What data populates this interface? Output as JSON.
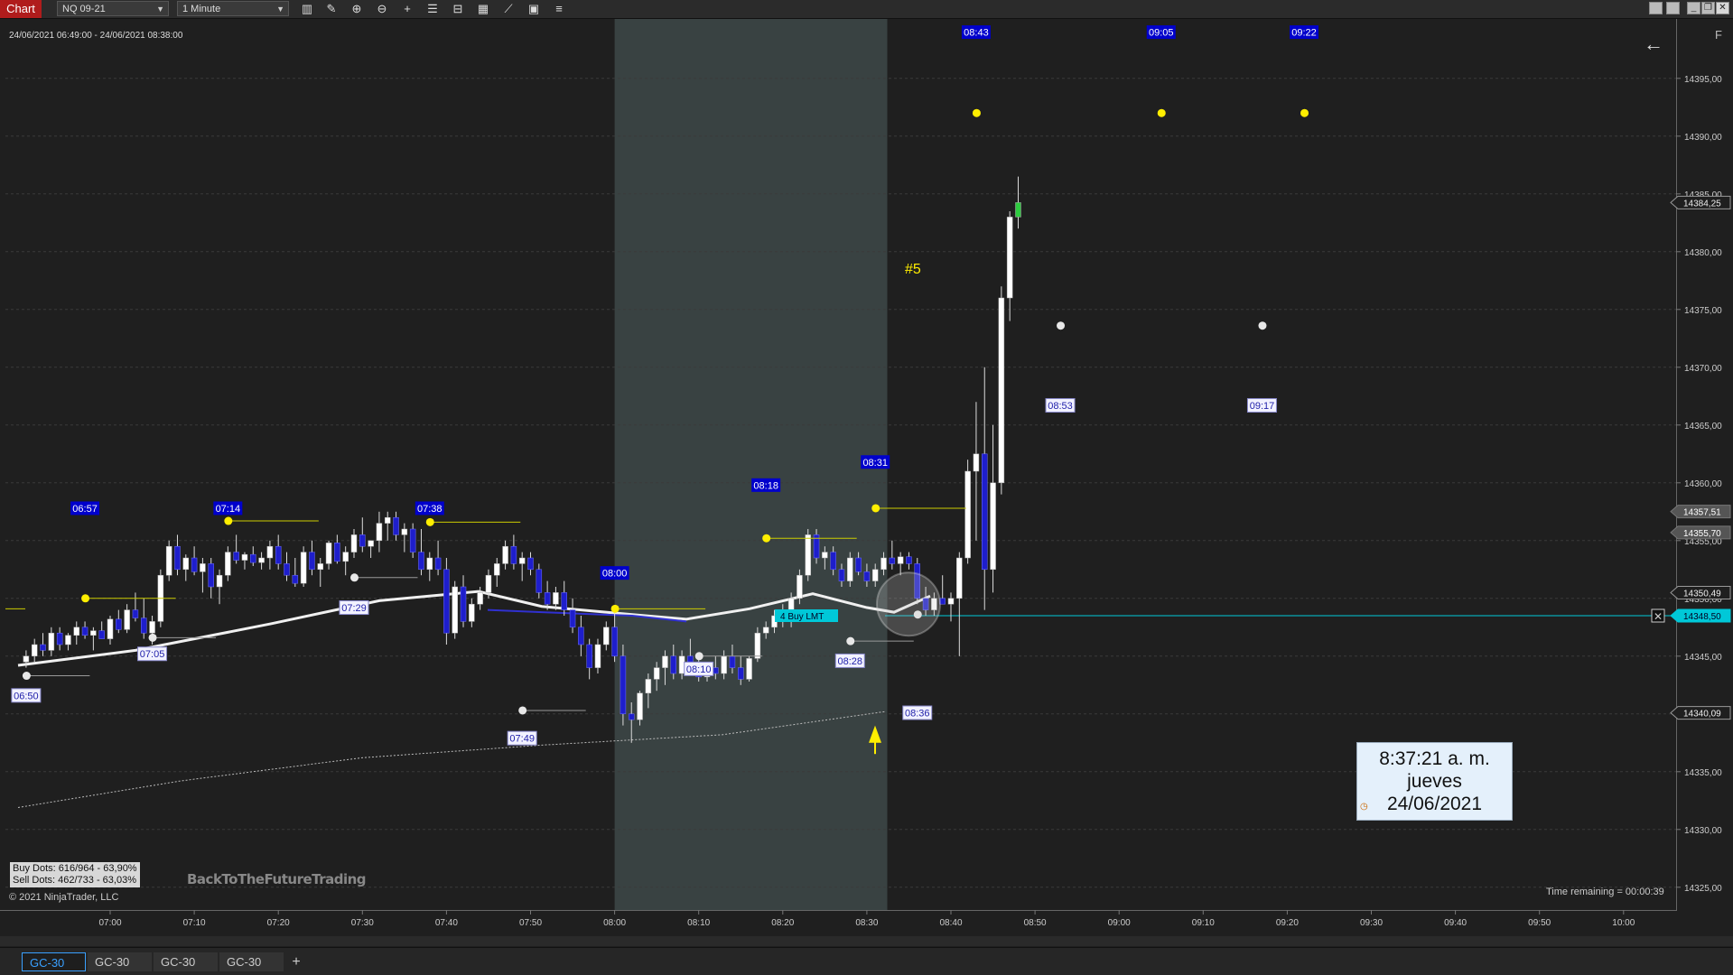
{
  "toolbar": {
    "chart_tab": "Chart",
    "instrument": "NQ 09-21",
    "interval": "1 Minute",
    "icons": [
      "bars-icon",
      "draw-icon",
      "zoom-in-icon",
      "zoom-out-icon",
      "crosshair-icon",
      "properties-icon",
      "templates-icon",
      "indicators-icon",
      "strategies-icon",
      "data-box-icon",
      "list-icon"
    ],
    "window_buttons": [
      "",
      "",
      "",
      "✕"
    ]
  },
  "chart": {
    "range_label": "24/06/2021 06:49:00 - 24/06/2021 08:38:00",
    "back_arrow": "←",
    "f_label": "F",
    "signal_label": "#5",
    "dots_box": [
      "Buy Dots: 616/964 - 63,90%",
      "Sell Dots: 462/733 - 63,03%"
    ],
    "watermark": "BackToTheFutureTrading",
    "copyright": "© 2021 NinjaTrader, LLC",
    "time_remaining": "Time remaining = 00:00:39",
    "order_label": "4  Buy LMT",
    "info_box": [
      "8:37:21 a. m.",
      "jueves",
      "24/06/2021"
    ],
    "colors": {
      "background": "#1f1f1f",
      "session_shade": "#394242",
      "up_candle": "#ffffff",
      "down_candle": "#1e1ecc",
      "last_bar": "#2ecc40",
      "order_line": "#00c8d8",
      "dots_yellow": "#ffee00",
      "label_blue": "#0000cc"
    }
  },
  "chart_data": {
    "type": "candlestick",
    "instrument": "NQ 09-21",
    "x_tick_labels": [
      "07:00",
      "07:10",
      "07:20",
      "07:30",
      "07:40",
      "07:50",
      "08:00",
      "08:10",
      "08:20",
      "08:30",
      "08:40",
      "08:50",
      "09:00",
      "09:10",
      "09:20",
      "09:30",
      "09:40",
      "09:50",
      "10:00"
    ],
    "y_tick_labels": [
      "14395,00",
      "14390,00",
      "14385,00",
      "14380,00",
      "14375,00",
      "14370,00",
      "14365,00",
      "14360,00",
      "14355,00",
      "14350,00",
      "14345,00",
      "14340,00",
      "14335,00",
      "14330,00",
      "14325,00"
    ],
    "y_range": [
      14324,
      14398
    ],
    "price_markers": [
      {
        "value": "14384,25",
        "style": "dark"
      },
      {
        "value": "14357,51",
        "style": "gray"
      },
      {
        "value": "14355,70",
        "style": "gray"
      },
      {
        "value": "14350,49",
        "style": "dark"
      },
      {
        "value": "14348,50",
        "style": "cyan"
      },
      {
        "value": "14340,09",
        "style": "dark"
      }
    ],
    "time_labels_high": [
      {
        "text": "06:57",
        "price": 14357.8
      },
      {
        "text": "07:14",
        "price": 14357.8
      },
      {
        "text": "07:38",
        "price": 14357.8
      },
      {
        "text": "08:00",
        "price": 14352.2
      },
      {
        "text": "08:18",
        "price": 14359.8
      },
      {
        "text": "08:31",
        "price": 14361.8
      },
      {
        "text": "08:43",
        "price": 14399
      },
      {
        "text": "09:05",
        "price": 14399
      },
      {
        "text": "09:22",
        "price": 14399
      }
    ],
    "time_labels_low": [
      {
        "text": "06:50",
        "price": 14341.6
      },
      {
        "text": "07:05",
        "price": 14345.2
      },
      {
        "text": "07:29",
        "price": 14349.2
      },
      {
        "text": "08:10",
        "price": 14343.9
      },
      {
        "text": "08:28",
        "price": 14344.6
      },
      {
        "text": "07:49",
        "price": 14337.9
      },
      {
        "text": "08:36",
        "price": 14340.1
      },
      {
        "text": "08:53",
        "price": 14366.7
      },
      {
        "text": "09:17",
        "price": 14366.7
      }
    ],
    "yellow_dots": [
      {
        "t": "06:57",
        "price": 14350.0
      },
      {
        "t": "07:14",
        "price": 14356.7
      },
      {
        "t": "07:38",
        "price": 14356.6
      },
      {
        "t": "08:00",
        "price": 14349.1
      },
      {
        "t": "08:18",
        "price": 14355.2
      },
      {
        "t": "08:31",
        "price": 14357.8
      },
      {
        "t": "08:43",
        "price": 14392.0
      },
      {
        "t": "09:05",
        "price": 14392.0
      },
      {
        "t": "09:22",
        "price": 14392.0
      }
    ],
    "white_dots": [
      {
        "t": "06:50",
        "price": 14343.3
      },
      {
        "t": "07:05",
        "price": 14346.6
      },
      {
        "t": "07:29",
        "price": 14351.8
      },
      {
        "t": "07:49",
        "price": 14340.3
      },
      {
        "t": "08:10",
        "price": 14345.0
      },
      {
        "t": "08:28",
        "price": 14346.3
      },
      {
        "t": "08:36",
        "price": 14348.6
      },
      {
        "t": "08:53",
        "price": 14373.6
      },
      {
        "t": "09:17",
        "price": 14373.6
      }
    ],
    "order_price": 14348.5,
    "shaded_session": [
      "08:00",
      "08:32"
    ],
    "candles": [
      [
        14344.5,
        14345.5,
        14344.0,
        14345.0
      ],
      [
        14345.0,
        14346.5,
        14344.5,
        14346.0
      ],
      [
        14346.0,
        14347.0,
        14345.0,
        14345.5
      ],
      [
        14345.5,
        14347.5,
        14345.0,
        14347.0
      ],
      [
        14347.0,
        14347.5,
        14345.5,
        14346.0
      ],
      [
        14346.0,
        14347.0,
        14345.5,
        14346.8
      ],
      [
        14346.8,
        14348.0,
        14346.0,
        14347.5
      ],
      [
        14347.5,
        14348.0,
        14346.5,
        14346.8
      ],
      [
        14346.8,
        14347.5,
        14345.5,
        14347.2
      ],
      [
        14347.2,
        14348.0,
        14346.5,
        14346.5
      ],
      [
        14346.5,
        14348.5,
        14346.0,
        14348.2
      ],
      [
        14348.2,
        14349.0,
        14347.0,
        14347.3
      ],
      [
        14347.3,
        14349.5,
        14347.0,
        14349.0
      ],
      [
        14349.0,
        14350.5,
        14348.0,
        14348.3
      ],
      [
        14348.3,
        14350.0,
        14346.5,
        14347.0
      ],
      [
        14347.0,
        14348.5,
        14346.0,
        14348.0
      ],
      [
        14348.0,
        14352.5,
        14347.5,
        14352.0
      ],
      [
        14352.0,
        14355.0,
        14351.5,
        14354.5
      ],
      [
        14354.5,
        14355.5,
        14352.0,
        14352.5
      ],
      [
        14352.5,
        14353.8,
        14351.5,
        14353.5
      ],
      [
        14353.5,
        14354.5,
        14352.0,
        14352.3
      ],
      [
        14352.3,
        14353.5,
        14350.5,
        14353.0
      ],
      [
        14353.0,
        14353.5,
        14350.0,
        14351.0
      ],
      [
        14351.0,
        14352.5,
        14349.5,
        14352.0
      ],
      [
        14352.0,
        14354.5,
        14351.5,
        14354.0
      ],
      [
        14354.0,
        14355.5,
        14353.0,
        14353.3
      ],
      [
        14353.3,
        14354.0,
        14352.5,
        14353.8
      ],
      [
        14353.8,
        14354.5,
        14352.8,
        14353.1
      ],
      [
        14353.1,
        14354.0,
        14352.5,
        14353.5
      ],
      [
        14353.5,
        14355.0,
        14352.5,
        14354.5
      ],
      [
        14354.5,
        14355.5,
        14352.5,
        14353.0
      ],
      [
        14353.0,
        14354.0,
        14351.5,
        14352.0
      ],
      [
        14352.0,
        14353.5,
        14351.0,
        14351.3
      ],
      [
        14351.3,
        14354.5,
        14351.0,
        14354.0
      ],
      [
        14354.0,
        14355.0,
        14352.0,
        14352.5
      ],
      [
        14352.5,
        14353.5,
        14351.0,
        14353.0
      ],
      [
        14353.0,
        14355.0,
        14352.5,
        14354.8
      ],
      [
        14354.8,
        14355.5,
        14353.0,
        14353.2
      ],
      [
        14353.2,
        14354.5,
        14352.0,
        14354.0
      ],
      [
        14354.0,
        14356.0,
        14353.5,
        14355.5
      ],
      [
        14355.5,
        14357.0,
        14354.0,
        14354.5
      ],
      [
        14354.5,
        14355.0,
        14353.5,
        14355.0
      ],
      [
        14355.0,
        14357.5,
        14354.0,
        14356.5
      ],
      [
        14356.5,
        14357.5,
        14355.0,
        14357.0
      ],
      [
        14357.0,
        14357.5,
        14355.0,
        14355.5
      ],
      [
        14355.5,
        14356.5,
        14354.0,
        14356.0
      ],
      [
        14356.0,
        14356.5,
        14353.5,
        14354.0
      ],
      [
        14354.0,
        14356.0,
        14352.0,
        14352.5
      ],
      [
        14352.5,
        14354.0,
        14351.5,
        14353.5
      ],
      [
        14353.5,
        14355.0,
        14352.0,
        14352.5
      ],
      [
        14352.5,
        14353.5,
        14346.0,
        14347.0
      ],
      [
        14347.0,
        14351.5,
        14346.5,
        14351.0
      ],
      [
        14351.0,
        14352.0,
        14347.5,
        14348.0
      ],
      [
        14348.0,
        14350.0,
        14347.5,
        14349.5
      ],
      [
        14349.5,
        14351.0,
        14349.0,
        14350.5
      ],
      [
        14350.5,
        14352.5,
        14350.0,
        14352.0
      ],
      [
        14352.0,
        14353.5,
        14351.0,
        14353.0
      ],
      [
        14353.0,
        14355.0,
        14352.5,
        14354.5
      ],
      [
        14354.5,
        14355.5,
        14352.5,
        14353.0
      ],
      [
        14353.0,
        14354.0,
        14351.5,
        14353.5
      ],
      [
        14353.5,
        14354.0,
        14352.0,
        14352.5
      ],
      [
        14352.5,
        14353.0,
        14350.0,
        14350.5
      ],
      [
        14350.5,
        14351.5,
        14349.0,
        14349.5
      ],
      [
        14349.5,
        14351.0,
        14349.0,
        14350.5
      ],
      [
        14350.5,
        14351.5,
        14348.5,
        14349.0
      ],
      [
        14349.0,
        14350.0,
        14347.0,
        14347.5
      ],
      [
        14347.5,
        14348.5,
        14345.0,
        14346.0
      ],
      [
        14346.0,
        14346.5,
        14343.0,
        14344.0
      ],
      [
        14344.0,
        14346.5,
        14343.5,
        14346.0
      ],
      [
        14346.0,
        14348.0,
        14345.5,
        14347.5
      ],
      [
        14347.5,
        14349.0,
        14344.5,
        14345.0
      ],
      [
        14345.0,
        14346.0,
        14339.0,
        14340.0
      ],
      [
        14340.0,
        14341.0,
        14337.5,
        14339.5
      ],
      [
        14339.5,
        14342.0,
        14339.0,
        14341.8
      ],
      [
        14341.8,
        14343.5,
        14340.5,
        14343.0
      ],
      [
        14343.0,
        14344.5,
        14342.0,
        14344.0
      ],
      [
        14344.0,
        14345.5,
        14342.5,
        14345.0
      ],
      [
        14345.0,
        14346.0,
        14343.0,
        14343.5
      ],
      [
        14343.5,
        14345.5,
        14343.0,
        14345.0
      ],
      [
        14345.0,
        14346.5,
        14344.0,
        14344.5
      ],
      [
        14344.5,
        14345.0,
        14342.8,
        14343.2
      ],
      [
        14343.2,
        14344.5,
        14342.8,
        14344.0
      ],
      [
        14344.0,
        14345.0,
        14343.0,
        14343.5
      ],
      [
        14343.5,
        14345.5,
        14343.0,
        14345.0
      ],
      [
        14345.0,
        14346.0,
        14343.5,
        14344.0
      ],
      [
        14344.0,
        14345.0,
        14342.5,
        14343.0
      ],
      [
        14343.0,
        14345.0,
        14342.8,
        14344.8
      ],
      [
        14344.8,
        14347.5,
        14344.5,
        14347.0
      ],
      [
        14347.0,
        14348.0,
        14346.5,
        14347.5
      ],
      [
        14347.5,
        14349.0,
        14347.0,
        14348.5
      ],
      [
        14348.5,
        14349.5,
        14347.5,
        14348.0
      ],
      [
        14348.0,
        14350.5,
        14347.5,
        14350.0
      ],
      [
        14350.0,
        14352.5,
        14349.5,
        14352.0
      ],
      [
        14352.0,
        14356.0,
        14351.5,
        14355.5
      ],
      [
        14355.5,
        14356.0,
        14353.0,
        14353.5
      ],
      [
        14353.5,
        14354.5,
        14352.5,
        14354.0
      ],
      [
        14354.0,
        14354.5,
        14352.0,
        14352.5
      ],
      [
        14352.5,
        14353.0,
        14351.0,
        14351.5
      ],
      [
        14351.5,
        14354.0,
        14351.0,
        14353.5
      ],
      [
        14353.5,
        14354.0,
        14352.0,
        14352.3
      ],
      [
        14352.3,
        14353.0,
        14351.0,
        14351.5
      ],
      [
        14351.5,
        14353.0,
        14351.0,
        14352.5
      ],
      [
        14352.5,
        14354.0,
        14352.0,
        14353.5
      ],
      [
        14353.5,
        14355.0,
        14352.5,
        14353.0
      ],
      [
        14353.0,
        14354.0,
        14352.0,
        14353.6
      ],
      [
        14353.6,
        14354.0,
        14352.5,
        14353.0
      ],
      [
        14353.0,
        14353.5,
        14349.5,
        14350.0
      ],
      [
        14350.0,
        14351.0,
        14348.5,
        14349.0
      ],
      [
        14349.0,
        14350.5,
        14348.5,
        14350.0
      ],
      [
        14350.0,
        14352.0,
        14349.5,
        14349.5
      ],
      [
        14349.5,
        14350.5,
        14348.0,
        14350.0
      ],
      [
        14350.0,
        14354.0,
        14345.0,
        14353.5
      ],
      [
        14353.5,
        14362.0,
        14353.0,
        14361.0
      ],
      [
        14361.0,
        14367.0,
        14355.0,
        14362.5
      ],
      [
        14362.5,
        14370.0,
        14349.0,
        14352.5
      ],
      [
        14352.5,
        14365.0,
        14350.5,
        14360.0
      ],
      [
        14360.0,
        14377.0,
        14359.0,
        14376.0
      ],
      [
        14376.0,
        14383.5,
        14374.0,
        14383.0
      ],
      [
        14383.0,
        14386.5,
        14382.0,
        14384.25
      ]
    ]
  },
  "bottom_tabs": {
    "tabs": [
      "GC-30",
      "GC-30",
      "GC-30",
      "GC-30"
    ],
    "active": 0,
    "add": "+"
  }
}
